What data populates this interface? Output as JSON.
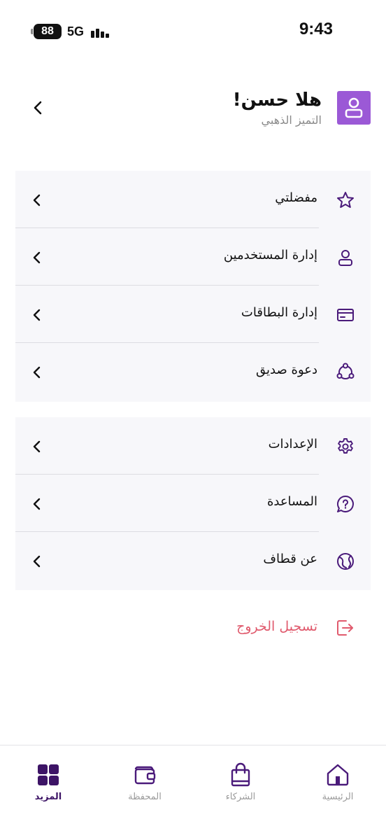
{
  "status_bar": {
    "battery": "88",
    "network": "5G",
    "time": "9:43"
  },
  "profile": {
    "greeting": "هلا حسن!",
    "tier": "التميز الذهبي",
    "avatar_icon": "user-avatar-icon",
    "accent_color": "#9b59d6"
  },
  "menu": {
    "group1": [
      {
        "label": "مفضلتي",
        "icon": "star-icon"
      },
      {
        "label": "إدارة المستخدمين",
        "icon": "user-icon"
      },
      {
        "label": "إدارة البطاقات",
        "icon": "card-icon"
      },
      {
        "label": "دعوة صديق",
        "icon": "share-icon"
      }
    ],
    "group2": [
      {
        "label": "الإعدادات",
        "icon": "gear-icon"
      },
      {
        "label": "المساعدة",
        "icon": "help-icon"
      },
      {
        "label": "عن قطاف",
        "icon": "globe-icon"
      }
    ]
  },
  "logout": {
    "label": "تسجيل الخروج",
    "icon": "logout-icon",
    "color": "#e05a6d"
  },
  "bottom_nav": [
    {
      "label": "الرئيسية",
      "icon": "home-icon",
      "active": false
    },
    {
      "label": "الشركاء",
      "icon": "shopping-bag-icon",
      "active": false
    },
    {
      "label": "المحفظة",
      "icon": "wallet-icon",
      "active": false
    },
    {
      "label": "المزيد",
      "icon": "grid-icon",
      "active": true
    }
  ],
  "colors": {
    "primary": "#3d1466",
    "icon_stroke": "#4a1a7a",
    "muted": "#9a9a9a",
    "group_background": "#f7f7fa"
  }
}
